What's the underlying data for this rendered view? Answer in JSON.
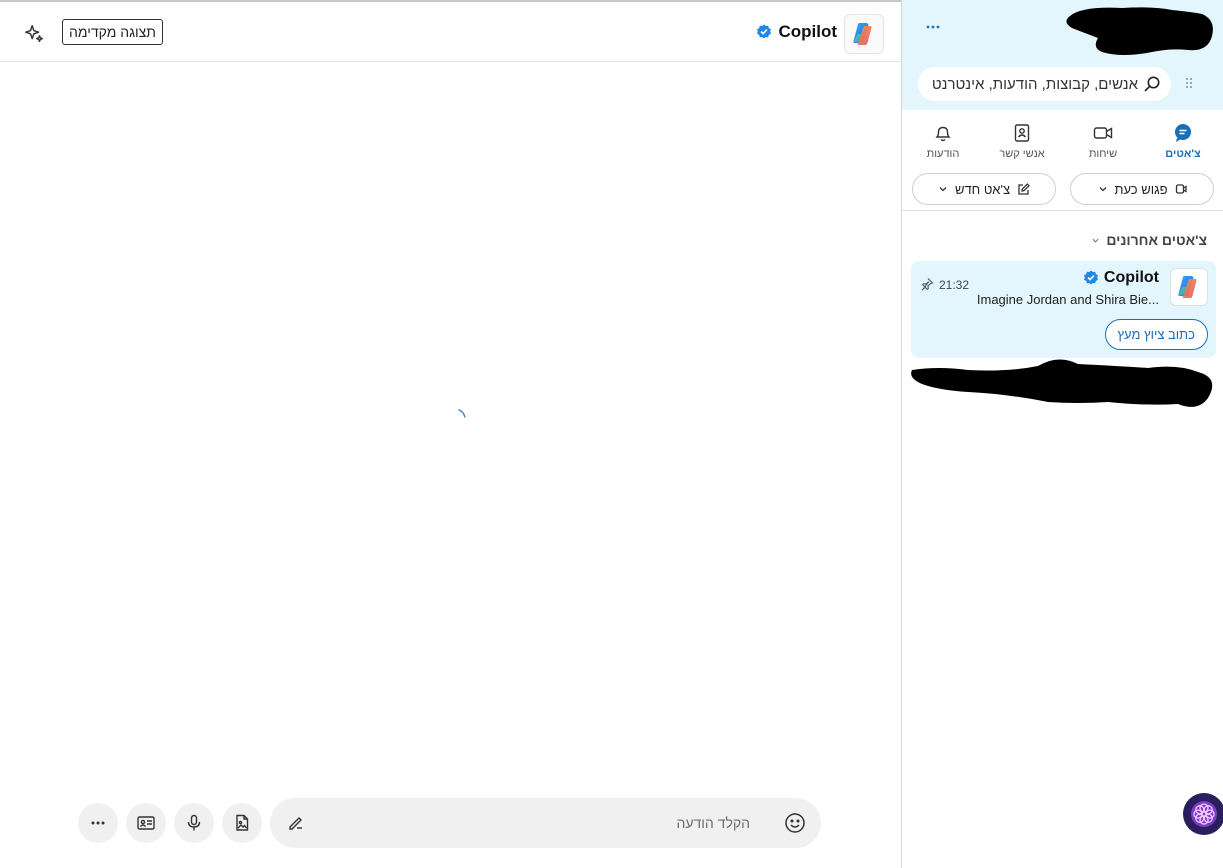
{
  "chat": {
    "title": "Copilot",
    "preview_button": "תצוגה מקדימה",
    "composer": {
      "placeholder": "הקלד הודעה"
    }
  },
  "sidebar": {
    "search_placeholder": "אנשים, קבוצות, הודעות, אינטרנט",
    "tabs": [
      {
        "label": "צ'אטים",
        "icon": "chat-icon",
        "active": true
      },
      {
        "label": "שיחות",
        "icon": "video-icon",
        "active": false
      },
      {
        "label": "אנשי קשר",
        "icon": "contacts-icon",
        "active": false
      },
      {
        "label": "הודעות",
        "icon": "bell-icon",
        "active": false
      }
    ],
    "meet_now": "פגוש כעת",
    "new_chat": "צ'אט חדש",
    "recent_header": "צ'אטים אחרונים",
    "recent_chats": [
      {
        "name": "Copilot",
        "preview": "Imagine Jordan and Shira Bie...",
        "time": "21:32",
        "pinned": true,
        "action_label": "כתוב ציוץ מעץ"
      }
    ]
  },
  "colors": {
    "accent": "#1b6eb8",
    "sidebar_bg": "#e3f6fd",
    "verified": "#1e88e5"
  }
}
